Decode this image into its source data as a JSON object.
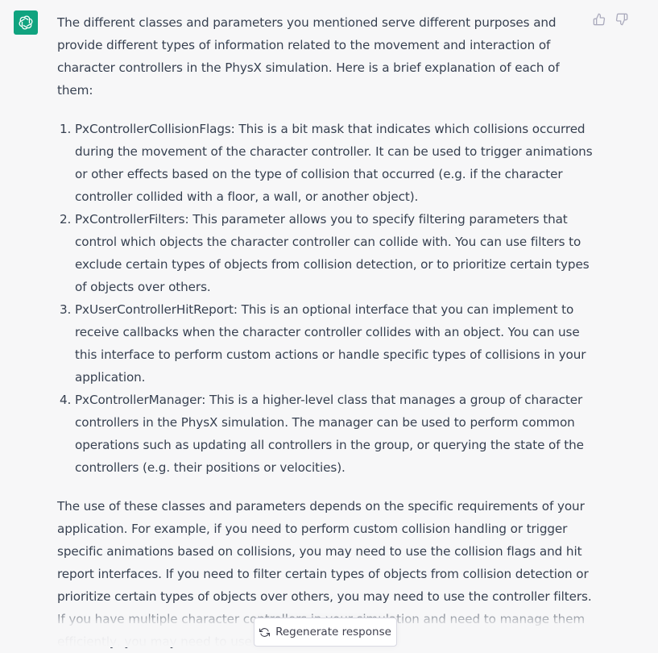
{
  "message": {
    "intro": "The different classes and parameters you mentioned serve different purposes and provide different types of information related to the movement and interaction of character controllers in the PhysX simulation. Here is a brief explanation of each of them:",
    "list": [
      "PxControllerCollisionFlags: This is a bit mask that indicates which collisions occurred during the movement of the character controller. It can be used to trigger animations or other effects based on the type of collision that occurred (e.g. if the character controller collided with a floor, a wall, or another object).",
      "PxControllerFilters: This parameter allows you to specify filtering parameters that control which objects the character controller can collide with. You can use filters to exclude certain types of objects from collision detection, or to prioritize certain types of objects over others.",
      "PxUserControllerHitReport: This is an optional interface that you can implement to receive callbacks when the character controller collides with an object. You can use this interface to perform custom actions or handle specific types of collisions in your application.",
      "PxControllerManager: This is a higher-level class that manages a group of character controllers in the PhysX simulation. The manager can be used to perform common operations such as updating all controllers in the group, or querying the state of the controllers (e.g. their positions or velocities)."
    ],
    "outro": "The use of these classes and parameters depends on the specific requirements of your application. For example, if you need to perform custom collision handling or trigger specific animations based on collisions, you may need to use the collision flags and hit report interfaces. If you need to filter certain types of objects from collision detection or prioritize certain types of objects over others, you may need to use the controller filters. If you have multiple character controllers in your simulation and need to manage them efficiently, you may need to use the controll"
  },
  "avatar": {
    "icon": "openai-logo-icon",
    "color": "#10a37f"
  },
  "feedback": {
    "thumbs_up_icon": "thumbs-up-icon",
    "thumbs_down_icon": "thumbs-down-icon"
  },
  "regenerate": {
    "label": "Regenerate response",
    "icon": "refresh-icon"
  }
}
